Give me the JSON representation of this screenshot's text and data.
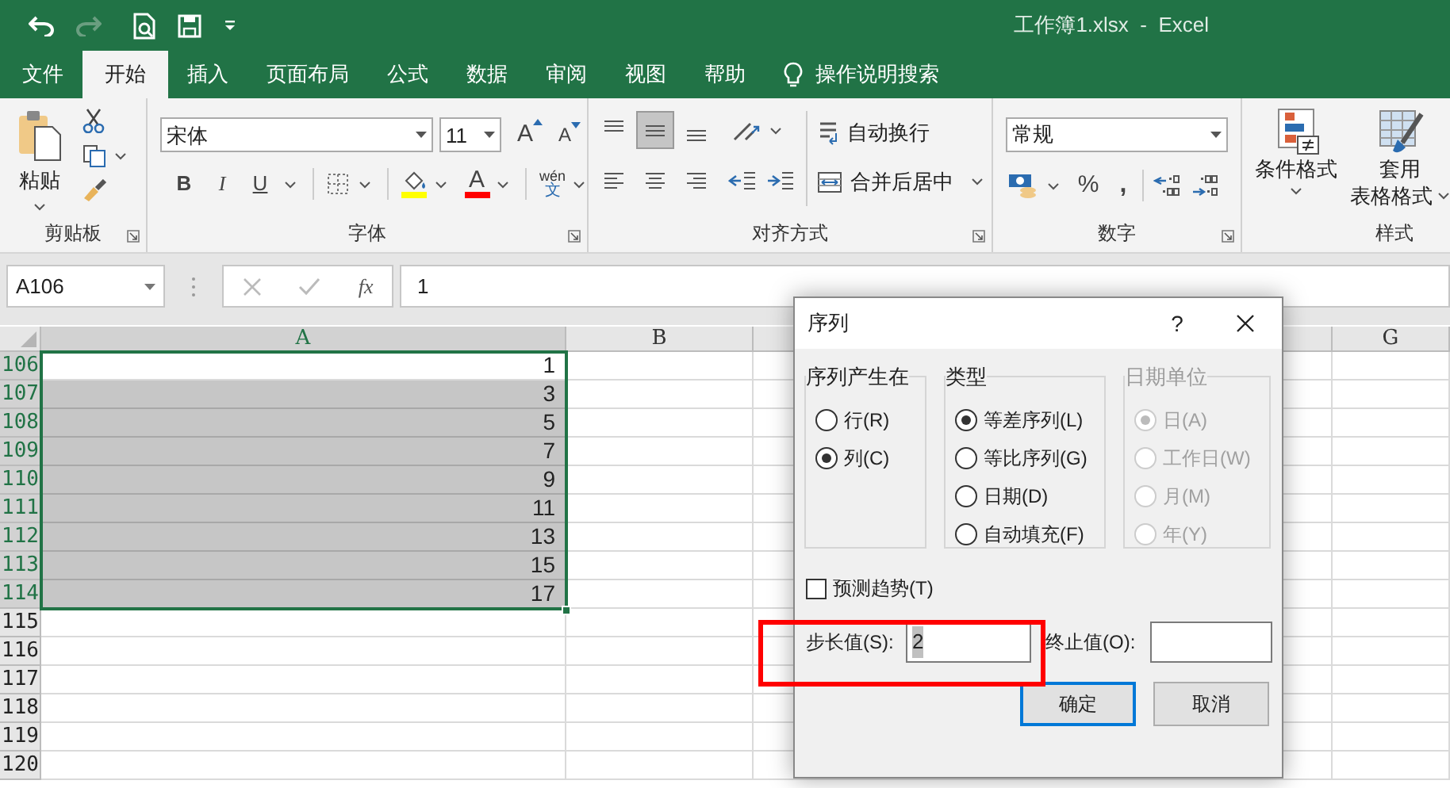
{
  "window": {
    "title": "工作簿1.xlsx  -  Excel"
  },
  "tabs": [
    {
      "label": "文件",
      "selected": false
    },
    {
      "label": "开始",
      "selected": true
    },
    {
      "label": "插入",
      "selected": false
    },
    {
      "label": "页面布局",
      "selected": false
    },
    {
      "label": "公式",
      "selected": false
    },
    {
      "label": "数据",
      "selected": false
    },
    {
      "label": "审阅",
      "selected": false
    },
    {
      "label": "视图",
      "selected": false
    },
    {
      "label": "帮助",
      "selected": false
    }
  ],
  "tell_me": "操作说明搜索",
  "ribbon": {
    "clipboard": {
      "label": "剪贴板",
      "paste": "粘贴"
    },
    "font": {
      "label": "字体",
      "font_name": "宋体",
      "font_size": "11",
      "grow": "A",
      "shrink": "A",
      "bold": "B",
      "italic": "I",
      "underline": "U",
      "font_color": "A",
      "phonetic_top": "wén",
      "phonetic_bottom": "文"
    },
    "alignment": {
      "label": "对齐方式",
      "wrap_text": "自动换行",
      "merge_center": "合并后居中"
    },
    "number": {
      "label": "数字",
      "format": "常规",
      "percent": "%",
      "comma": ","
    },
    "styles": {
      "label": "样式",
      "conditional_formatting": "条件格式",
      "format_as_table": [
        "套用",
        "表格格式"
      ]
    }
  },
  "formula_bar": {
    "name_box": "A106",
    "fx": "fx",
    "value": "1"
  },
  "sheet": {
    "columns": [
      {
        "label": "A",
        "selected": true
      },
      {
        "label": "B",
        "selected": false
      },
      {
        "label": "G",
        "selected": false
      }
    ],
    "rows": [
      {
        "header": "106",
        "value": "1",
        "selected": true,
        "active": true
      },
      {
        "header": "107",
        "value": "3",
        "selected": true,
        "active": false
      },
      {
        "header": "108",
        "value": "5",
        "selected": true,
        "active": false
      },
      {
        "header": "109",
        "value": "7",
        "selected": true,
        "active": false
      },
      {
        "header": "110",
        "value": "9",
        "selected": true,
        "active": false
      },
      {
        "header": "111",
        "value": "11",
        "selected": true,
        "active": false
      },
      {
        "header": "112",
        "value": "13",
        "selected": true,
        "active": false
      },
      {
        "header": "113",
        "value": "15",
        "selected": true,
        "active": false
      },
      {
        "header": "114",
        "value": "17",
        "selected": true,
        "active": false
      },
      {
        "header": "115",
        "selected": false,
        "active": false
      },
      {
        "header": "116",
        "selected": false,
        "active": false
      },
      {
        "header": "117",
        "selected": false,
        "active": false
      },
      {
        "header": "118",
        "selected": false,
        "active": false
      },
      {
        "header": "119",
        "selected": false,
        "active": false
      },
      {
        "header": "120",
        "selected": false,
        "active": false
      }
    ]
  },
  "dialog": {
    "title": "序列",
    "help": "?",
    "groups": [
      {
        "legend": "序列产生在",
        "disabled": false,
        "options": [
          {
            "label": "行(R)",
            "selected": false
          },
          {
            "label": "列(C)",
            "selected": true
          }
        ]
      },
      {
        "legend": "类型",
        "disabled": false,
        "options": [
          {
            "label": "等差序列(L)",
            "selected": true
          },
          {
            "label": "等比序列(G)",
            "selected": false
          },
          {
            "label": "日期(D)",
            "selected": false
          },
          {
            "label": "自动填充(F)",
            "selected": false
          }
        ]
      },
      {
        "legend": "日期单位",
        "disabled": true,
        "options": [
          {
            "label": "日(A)",
            "selected": true
          },
          {
            "label": "工作日(W)",
            "selected": false
          },
          {
            "label": "月(M)",
            "selected": false
          },
          {
            "label": "年(Y)",
            "selected": false
          }
        ]
      }
    ],
    "trend": {
      "label": "预测趋势(T)",
      "checked": false
    },
    "step": {
      "label": "步长值(S):",
      "value": "2"
    },
    "stop": {
      "label": "终止值(O):"
    },
    "buttons": [
      {
        "label": "确定",
        "default": true
      },
      {
        "label": "取消",
        "default": false
      }
    ]
  }
}
